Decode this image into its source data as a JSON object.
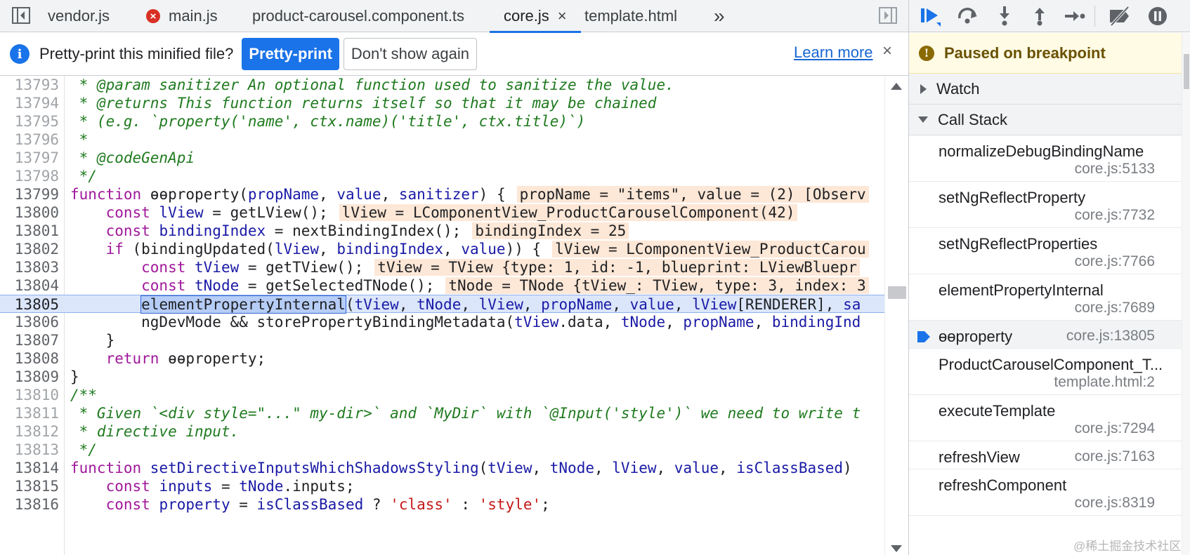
{
  "tabs": [
    {
      "label": "vendor.js",
      "error": false,
      "active": false
    },
    {
      "label": "main.js",
      "error": true,
      "active": false
    },
    {
      "label": "product-carousel.component.ts",
      "error": false,
      "active": false
    },
    {
      "label": "core.js",
      "error": false,
      "active": true
    },
    {
      "label": "template.html",
      "error": false,
      "active": false
    }
  ],
  "tabs_more": "»",
  "close_glyph": "×",
  "infobar": {
    "info_glyph": "i",
    "message": "Pretty-print this minified file?",
    "pretty_print_button": "Pretty-print",
    "dont_show_button": "Don't show again",
    "learn_more_link": "Learn more"
  },
  "code_lines": [
    {
      "num": "13793",
      "segs": [
        {
          "t": " * @param sanitizer An optional function used to sanitize the value.",
          "c": "c-com"
        }
      ]
    },
    {
      "num": "13794",
      "segs": [
        {
          "t": " * @returns This function returns itself so that it may be chained",
          "c": "c-com"
        }
      ]
    },
    {
      "num": "13795",
      "segs": [
        {
          "t": " * (e.g. `property('name', ctx.name)('title', ctx.title)`)",
          "c": "c-com"
        }
      ]
    },
    {
      "num": "13796",
      "segs": [
        {
          "t": " *",
          "c": "c-com"
        }
      ]
    },
    {
      "num": "13797",
      "segs": [
        {
          "t": " * @codeGenApi",
          "c": "c-com"
        }
      ]
    },
    {
      "num": "13798",
      "segs": [
        {
          "t": " */",
          "c": "c-com"
        }
      ]
    },
    {
      "num": "13799",
      "segs": [
        {
          "t": "function ",
          "c": "c-kw"
        },
        {
          "t": "ɵɵproperty",
          "c": "c-plain"
        },
        {
          "t": "(",
          "c": "c-plain"
        },
        {
          "t": "propName",
          "c": "c-var"
        },
        {
          "t": ", ",
          "c": "c-plain"
        },
        {
          "t": "value",
          "c": "c-var"
        },
        {
          "t": ", ",
          "c": "c-plain"
        },
        {
          "t": "sanitizer",
          "c": "c-var"
        },
        {
          "t": ") {",
          "c": "c-plain"
        },
        {
          "t": "propName = \"items\", value = (2) [Observ",
          "c": "inl"
        }
      ]
    },
    {
      "num": "13800",
      "segs": [
        {
          "t": "    const ",
          "c": "c-kw"
        },
        {
          "t": "lView",
          "c": "c-var"
        },
        {
          "t": " = getLView();",
          "c": "c-plain"
        },
        {
          "t": "lView = LComponentView_ProductCarouselComponent(42)",
          "c": "inl"
        }
      ]
    },
    {
      "num": "13801",
      "segs": [
        {
          "t": "    const ",
          "c": "c-kw"
        },
        {
          "t": "bindingIndex",
          "c": "c-var"
        },
        {
          "t": " = nextBindingIndex();",
          "c": "c-plain"
        },
        {
          "t": "bindingIndex = 25",
          "c": "inl"
        }
      ]
    },
    {
      "num": "13802",
      "segs": [
        {
          "t": "    if ",
          "c": "c-kw"
        },
        {
          "t": "(bindingUpdated(",
          "c": "c-plain"
        },
        {
          "t": "lView",
          "c": "c-var"
        },
        {
          "t": ", ",
          "c": "c-plain"
        },
        {
          "t": "bindingIndex",
          "c": "c-var"
        },
        {
          "t": ", ",
          "c": "c-plain"
        },
        {
          "t": "value",
          "c": "c-var"
        },
        {
          "t": ")) {",
          "c": "c-plain"
        },
        {
          "t": "lView = LComponentView_ProductCarou",
          "c": "inl"
        }
      ]
    },
    {
      "num": "13803",
      "segs": [
        {
          "t": "        const ",
          "c": "c-kw"
        },
        {
          "t": "tView",
          "c": "c-var"
        },
        {
          "t": " = getTView();",
          "c": "c-plain"
        },
        {
          "t": "tView = TView {type: 1, id: -1, blueprint: LViewBluepr",
          "c": "inl"
        }
      ]
    },
    {
      "num": "13804",
      "segs": [
        {
          "t": "        const ",
          "c": "c-kw"
        },
        {
          "t": "tNode",
          "c": "c-var"
        },
        {
          "t": " = getSelectedTNode();",
          "c": "c-plain"
        },
        {
          "t": "tNode = TNode {tView_: TView, type: 3, index: 3",
          "c": "inl"
        }
      ]
    },
    {
      "num": "13805",
      "exec": true,
      "segs": [
        {
          "t": "        ",
          "c": "c-plain"
        },
        {
          "t": "elementPropertyInternal",
          "c": "curfn"
        },
        {
          "t": "(",
          "c": "c-plain"
        },
        {
          "t": "tView",
          "c": "c-var"
        },
        {
          "t": ", ",
          "c": "c-plain"
        },
        {
          "t": "tNode",
          "c": "c-var"
        },
        {
          "t": ", ",
          "c": "c-plain"
        },
        {
          "t": "lView",
          "c": "c-var"
        },
        {
          "t": ", ",
          "c": "c-plain"
        },
        {
          "t": "propName",
          "c": "c-var"
        },
        {
          "t": ", ",
          "c": "c-plain"
        },
        {
          "t": "value",
          "c": "c-var"
        },
        {
          "t": ", ",
          "c": "c-plain"
        },
        {
          "t": "lView",
          "c": "c-var"
        },
        {
          "t": "[RENDERER], ",
          "c": "c-plain"
        },
        {
          "t": "sa",
          "c": "c-var"
        }
      ]
    },
    {
      "num": "13806",
      "segs": [
        {
          "t": "        ngDevMode && storePropertyBindingMetadata(",
          "c": "c-plain"
        },
        {
          "t": "tView",
          "c": "c-var"
        },
        {
          "t": ".data, ",
          "c": "c-plain"
        },
        {
          "t": "tNode",
          "c": "c-var"
        },
        {
          "t": ", ",
          "c": "c-plain"
        },
        {
          "t": "propName",
          "c": "c-var"
        },
        {
          "t": ", ",
          "c": "c-plain"
        },
        {
          "t": "bindingInd",
          "c": "c-var"
        }
      ]
    },
    {
      "num": "13807",
      "segs": [
        {
          "t": "    }",
          "c": "c-plain"
        }
      ]
    },
    {
      "num": "13808",
      "segs": [
        {
          "t": "    return ",
          "c": "c-kw"
        },
        {
          "t": "ɵɵproperty;",
          "c": "c-plain"
        }
      ]
    },
    {
      "num": "13809",
      "segs": [
        {
          "t": "}",
          "c": "c-plain"
        }
      ]
    },
    {
      "num": "13810",
      "segs": [
        {
          "t": "/**",
          "c": "c-com"
        }
      ]
    },
    {
      "num": "13811",
      "segs": [
        {
          "t": " * Given `<div style=\"...\" my-dir>` and `MyDir` with `@Input('style')` we need to write t",
          "c": "c-com"
        }
      ]
    },
    {
      "num": "13812",
      "segs": [
        {
          "t": " * directive input.",
          "c": "c-com"
        }
      ]
    },
    {
      "num": "13813",
      "segs": [
        {
          "t": " */",
          "c": "c-com"
        }
      ]
    },
    {
      "num": "13814",
      "segs": [
        {
          "t": "function ",
          "c": "c-kw"
        },
        {
          "t": "setDirectiveInputsWhichShadowsStyling",
          "c": "c-def"
        },
        {
          "t": "(",
          "c": "c-plain"
        },
        {
          "t": "tView",
          "c": "c-var"
        },
        {
          "t": ", ",
          "c": "c-plain"
        },
        {
          "t": "tNode",
          "c": "c-var"
        },
        {
          "t": ", ",
          "c": "c-plain"
        },
        {
          "t": "lView",
          "c": "c-var"
        },
        {
          "t": ", ",
          "c": "c-plain"
        },
        {
          "t": "value",
          "c": "c-var"
        },
        {
          "t": ", ",
          "c": "c-plain"
        },
        {
          "t": "isClassBased",
          "c": "c-var"
        },
        {
          "t": ")",
          "c": "c-plain"
        }
      ]
    },
    {
      "num": "13815",
      "segs": [
        {
          "t": "    const ",
          "c": "c-kw"
        },
        {
          "t": "inputs",
          "c": "c-var"
        },
        {
          "t": " = ",
          "c": "c-plain"
        },
        {
          "t": "tNode",
          "c": "c-var"
        },
        {
          "t": ".inputs;",
          "c": "c-plain"
        }
      ]
    },
    {
      "num": "13816",
      "segs": [
        {
          "t": "    const ",
          "c": "c-kw"
        },
        {
          "t": "property",
          "c": "c-var"
        },
        {
          "t": " = ",
          "c": "c-plain"
        },
        {
          "t": "isClassBased",
          "c": "c-var"
        },
        {
          "t": " ? ",
          "c": "c-plain"
        },
        {
          "t": "'class'",
          "c": "c-str"
        },
        {
          "t": " : ",
          "c": "c-plain"
        },
        {
          "t": "'style'",
          "c": "c-str"
        },
        {
          "t": ";",
          "c": "c-plain"
        }
      ]
    }
  ],
  "debugger": {
    "paused_glyph": "!",
    "paused_text": "Paused on breakpoint",
    "watch_label": "Watch",
    "callstack_label": "Call Stack",
    "frames": [
      {
        "fn": "normalizeDebugBindingName",
        "loc": "core.js:5133",
        "current": false
      },
      {
        "fn": "setNgReflectProperty",
        "loc": "core.js:7732",
        "current": false
      },
      {
        "fn": "setNgReflectProperties",
        "loc": "core.js:7766",
        "current": false
      },
      {
        "fn": "elementPropertyInternal",
        "loc": "core.js:7689",
        "current": false
      },
      {
        "fn": "ɵɵproperty",
        "loc": "core.js:13805",
        "current": true
      },
      {
        "fn": "ProductCarouselComponent_T...",
        "loc": "template.html:2",
        "current": false
      },
      {
        "fn": "executeTemplate",
        "loc": "core.js:7294",
        "current": false
      },
      {
        "fn": "refreshView",
        "loc": "core.js:7163",
        "current": false
      },
      {
        "fn": "refreshComponent",
        "loc": "core.js:8319",
        "current": false
      }
    ]
  },
  "watermark": "@稀土掘金技术社区"
}
